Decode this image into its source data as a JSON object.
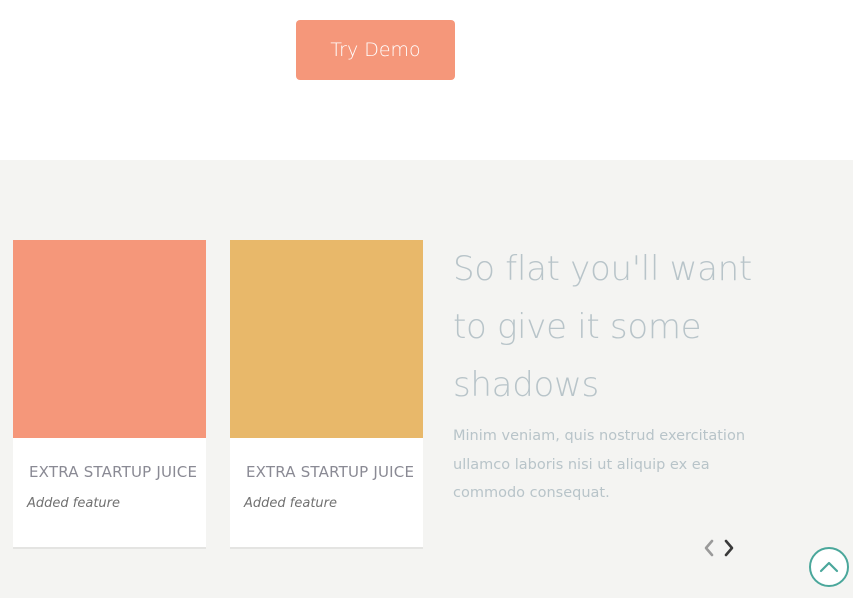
{
  "demo": {
    "button_label": "Try Demo"
  },
  "cards": [
    {
      "title": "EXTRA STARTUP JUICE",
      "subtitle": "Added feature",
      "color": "#f5977a"
    },
    {
      "title": "EXTRA STARTUP JUICE",
      "subtitle": "Added feature",
      "color": "#e8b86a"
    }
  ],
  "feature": {
    "headline": "So flat you'll want to give it some shadows",
    "body": "Minim veniam, quis nostrud exercitation ullamco laboris nisi ut aliquip ex ea commodo consequat."
  },
  "carousel": {
    "prev_icon": "chevron-left-icon",
    "next_icon": "chevron-right-icon"
  },
  "scroll_top": {
    "icon": "chevron-up-icon"
  },
  "colors": {
    "accent": "#f5977a",
    "gold": "#e8b86a",
    "section_bg": "#f4f4f2",
    "teal": "#4aa79b"
  }
}
